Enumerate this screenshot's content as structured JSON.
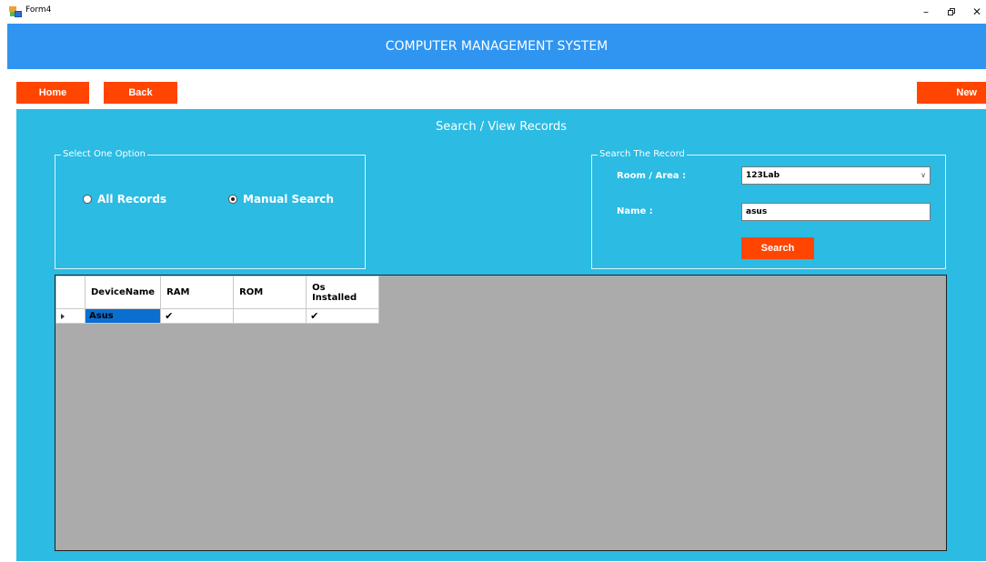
{
  "window": {
    "title": "Form4",
    "controls": {
      "minimize": "–",
      "close": "✕"
    }
  },
  "header": {
    "title": "COMPUTER MANAGEMENT SYSTEM"
  },
  "nav": {
    "home_label": "Home",
    "back_label": "Back",
    "new_label": "New"
  },
  "panel": {
    "title": "Search / View Records",
    "option_group": {
      "legend": "Select One Option",
      "options": [
        {
          "label": "All Records",
          "selected": false
        },
        {
          "label": "Manual Search",
          "selected": true
        }
      ]
    },
    "search_group": {
      "legend": "Search The Record",
      "room_label": "Room / Area :",
      "room_value": "123Lab",
      "name_label": "Name :",
      "name_value": "asus",
      "search_label": "Search"
    }
  },
  "grid": {
    "columns": [
      "DeviceName",
      "RAM",
      "ROM",
      "Os Installed"
    ],
    "rows": [
      {
        "DeviceName": "Asus",
        "RAM": "✔",
        "ROM": "",
        "Os Installed": "✔"
      }
    ]
  },
  "colors": {
    "banner": "#2f95f1",
    "panel": "#2bbbe3",
    "button": "#ff4500",
    "grid_bg": "#ababab",
    "selection": "#0a6fd1"
  },
  "icons": {
    "app": "form-app-icon",
    "radio": "radio-icon",
    "row_pointer": "row-arrow-icon",
    "dropdown": "chevron-down-icon",
    "check": "check-icon"
  }
}
